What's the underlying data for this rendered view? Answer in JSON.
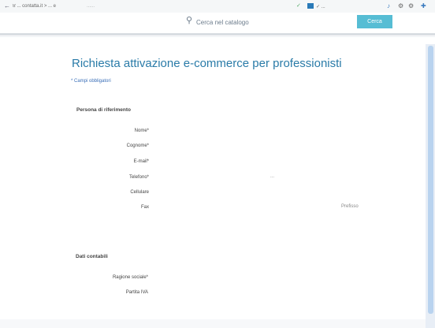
{
  "topbar": {
    "back_icon": "←",
    "breadcrumb": "ਖ਼ ... contatta.it > ... e",
    "breadcrumb_extra": "......",
    "mid_label": "✓ ...",
    "right_icons": [
      "♪",
      "⚙",
      "⚙",
      "✚"
    ]
  },
  "search": {
    "placeholder": "Cerca nel catalogo",
    "button_label": "Cerca"
  },
  "page": {
    "title": "Richiesta attivazione e-commerce per professionisti",
    "link": "* Campi obbligatori"
  },
  "sections": {
    "persona": "Persona di riferimento",
    "dati": "Dati contabili"
  },
  "fields": {
    "nome": "Nome*",
    "cognome": "Cognome*",
    "email": "E-mail*",
    "telefono": "Telefono*",
    "cellulare": "Cellulare",
    "fax": "Fax",
    "telefono_hint": "...",
    "fax_hint": "Prefisso",
    "ragione_sociale": "Ragione sociale*",
    "partita_iva": "Partita IVA"
  }
}
